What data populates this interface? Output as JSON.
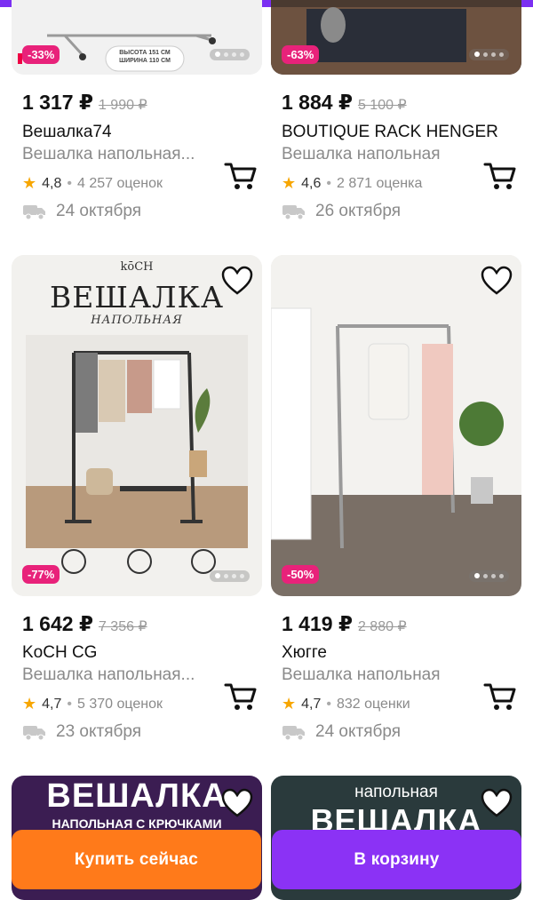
{
  "colors": {
    "accent": "#8b32f5",
    "buy": "#ff7a1a",
    "discount": "#e8227a",
    "star": "#f7a600"
  },
  "products": [
    {
      "discount": "-33%",
      "price": "1 317 ₽",
      "old_price": "1 990 ₽",
      "brand": "Вешалка74",
      "description": "Вешалка напольная...",
      "rating": "4,8",
      "reviews": "4 257 оценок",
      "delivery": "24 октября",
      "image_text": {
        "line1": "ВЫСОТА 151 СМ",
        "line2": "ШИРИНА 110 СМ"
      }
    },
    {
      "discount": "-63%",
      "price": "1 884 ₽",
      "old_price": "5 100 ₽",
      "brand": "BOUTIQUE RACK HENGER",
      "description": "Вешалка напольная",
      "rating": "4,6",
      "reviews": "2 871 оценка",
      "delivery": "26 октября"
    },
    {
      "discount": "-77%",
      "price": "1 642 ₽",
      "old_price": "7 356 ₽",
      "brand": "KoCH CG",
      "description": "Вешалка напольная...",
      "rating": "4,7",
      "reviews": "5 370 оценок",
      "delivery": "23 октября",
      "image_text": {
        "logo": "kōCH",
        "title": "ВЕШАЛКА",
        "subtitle": "НАПОЛЬНАЯ"
      }
    },
    {
      "discount": "-50%",
      "price": "1 419 ₽",
      "old_price": "2 880 ₽",
      "brand": "Хюгге",
      "description": "Вешалка напольная",
      "rating": "4,7",
      "reviews": "832 оценки",
      "delivery": "24 октября"
    },
    {
      "image_text": {
        "title": "ВЕШАЛКА",
        "subtitle": "НАПОЛЬНАЯ С КРЮЧКАМИ"
      }
    },
    {
      "image_text": {
        "title": "ВЕШАЛКА",
        "subtitle": "напольная"
      }
    }
  ],
  "actions": {
    "buy_now": "Купить сейчас",
    "add_to_cart": "В корзину"
  },
  "icons": {
    "heart": "heart-icon",
    "cart": "cart-icon",
    "star": "star-icon",
    "truck": "truck-icon"
  }
}
